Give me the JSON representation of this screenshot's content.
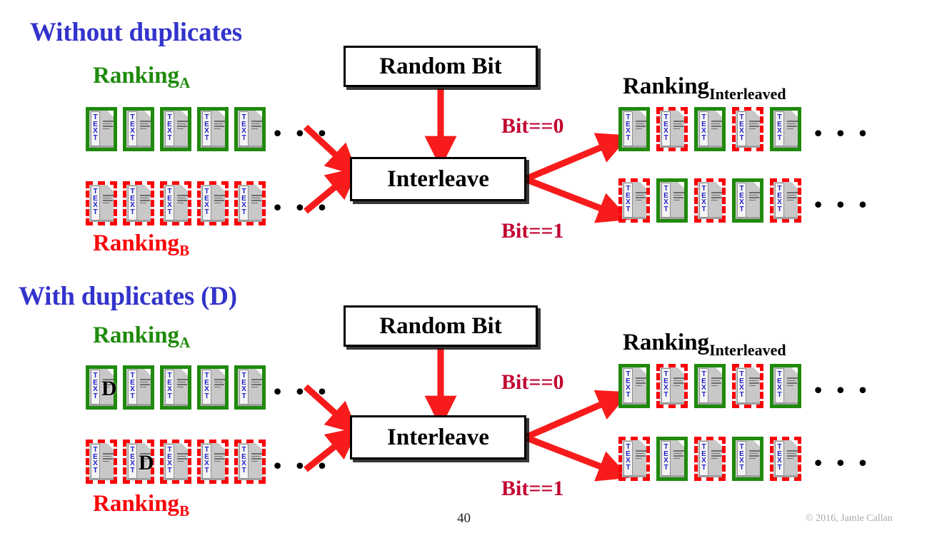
{
  "slide": {
    "page_number": "40",
    "copyright": "© 2016, Jamie Callan",
    "colors": {
      "heading": "#3333cc",
      "ranking_a": "#1f8a0c",
      "ranking_b": "#fb0007",
      "bit_label": "#c20430",
      "arrow": "#f81b1b",
      "doc_body": "#c8c8c8",
      "doc_text": "#2222cc"
    }
  },
  "panels": [
    {
      "id": "without-duplicates",
      "title": "Without duplicates",
      "ranking_a_label": "Ranking",
      "ranking_a_sub": "A",
      "ranking_b_label": "Ranking",
      "ranking_b_sub": "B",
      "ranking_interleaved_label": "Ranking",
      "ranking_interleaved_sub": "Interleaved",
      "random_bit_box": "Random Bit",
      "interleave_box": "Interleave",
      "bit_zero_label": "Bit==0",
      "bit_one_label": "Bit==1",
      "ellipsis": "• • •",
      "rows": {
        "ranking_a": [
          "green",
          "green",
          "green",
          "green",
          "green"
        ],
        "ranking_b": [
          "red",
          "red",
          "red",
          "red",
          "red"
        ],
        "interleaved_bit0": [
          "green",
          "red",
          "green",
          "red",
          "green"
        ],
        "interleaved_bit1": [
          "red",
          "green",
          "red",
          "green",
          "red"
        ]
      },
      "duplicates": []
    },
    {
      "id": "with-duplicates",
      "title": "With duplicates (D)",
      "ranking_a_label": "Ranking",
      "ranking_a_sub": "A",
      "ranking_b_label": "Ranking",
      "ranking_b_sub": "B",
      "ranking_interleaved_label": "Ranking",
      "ranking_interleaved_sub": "Interleaved",
      "random_bit_box": "Random Bit",
      "interleave_box": "Interleave",
      "bit_zero_label": "Bit==0",
      "bit_one_label": "Bit==1",
      "ellipsis": "• • •",
      "duplicate_marker": "D",
      "rows": {
        "ranking_a": [
          "green",
          "green",
          "green",
          "green",
          "green"
        ],
        "ranking_b": [
          "red",
          "red",
          "red",
          "red",
          "red"
        ],
        "interleaved_bit0": [
          "green",
          "red",
          "green",
          "red",
          "green"
        ],
        "interleaved_bit1": [
          "red",
          "green",
          "red",
          "green",
          "red"
        ]
      },
      "duplicates": [
        {
          "row": "ranking_a",
          "index": 0,
          "marker": "D"
        },
        {
          "row": "ranking_b",
          "index": 1,
          "marker": "D"
        }
      ]
    }
  ],
  "doc_icon": {
    "name": "document-icon",
    "text_glyphs": [
      "T",
      "E",
      "X",
      "T"
    ]
  }
}
